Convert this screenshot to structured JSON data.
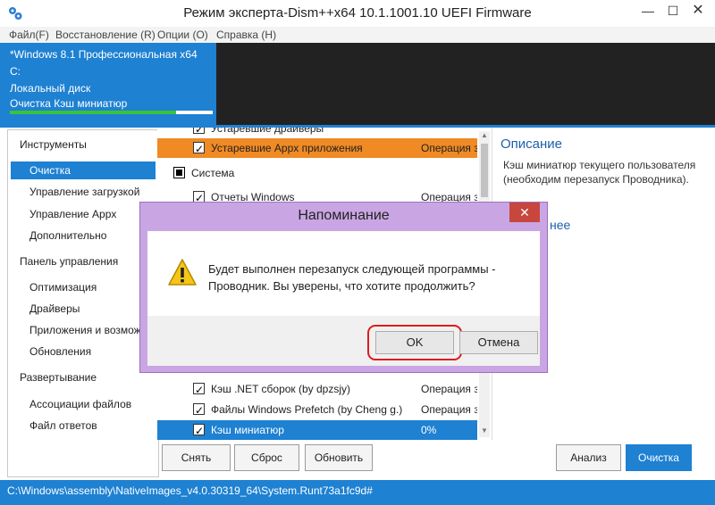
{
  "window": {
    "title": "Режим эксперта-Dism++x64 10.1.1001.10 UEFI Firmware",
    "minimize": "—",
    "maximize": "☐",
    "close": "✕"
  },
  "menu": {
    "items": [
      "Файл(F)",
      "Восстановление (R)",
      "Опции (O)",
      "Справка (H)"
    ]
  },
  "info_panel": {
    "os": "*Windows 8.1 Профессиональная x64",
    "drive": "C:",
    "disk_type": "Локальный диск",
    "task": "Очистка Кэш миниатюр",
    "progress": 0.82
  },
  "sidebar": {
    "sections": [
      {
        "title": "Инструменты",
        "items": [
          "Очистка",
          "Управление загрузкой",
          "Управление Appx",
          "Дополнительно"
        ]
      },
      {
        "title": "Панель управления",
        "items": [
          "Оптимизация",
          "Драйверы",
          "Приложения и возмож",
          "Обновления"
        ]
      },
      {
        "title": "Развертывание",
        "items": [
          "Ассоциации файлов",
          "Файл ответов"
        ]
      }
    ],
    "active_item": "Очистка"
  },
  "list": {
    "rows_top": [
      {
        "name": "Устаревшие драйверы",
        "status": "",
        "checked": true
      },
      {
        "name": "Устаревшие Appx приложения",
        "status": "Операция за",
        "checked": true
      }
    ],
    "group": "Система",
    "rows_mid": [
      {
        "name": "Отчеты Windows",
        "status": "Операция за",
        "checked": true
      }
    ],
    "rows_bottom": [
      {
        "name": "Кэш .NET сборок (by dpzsjy)",
        "status": "Операция за",
        "checked": true
      },
      {
        "name": "Файлы Windows Prefetch (by Cheng g.)",
        "status": "Операция за",
        "checked": true
      },
      {
        "name": "Кэш миниатюр",
        "status": "0%",
        "checked": true
      }
    ]
  },
  "description": {
    "title": "Описание",
    "text": "Кэш миниатюр текущего пользователя (необходим перезапуск Проводника).",
    "partial_heading": "нее"
  },
  "buttons": {
    "remove": "Снять",
    "reset": "Сброс",
    "refresh": "Обновить",
    "analyze": "Анализ",
    "clean": "Очистка"
  },
  "status": {
    "path": "C:\\Windows\\assembly\\NativeImages_v4.0.30319_64\\System.Runt73a1fc9d#"
  },
  "dialog": {
    "title": "Напоминание",
    "close": "✕",
    "message": "Будет выполнен перезапуск следующей программы - Проводник. Вы уверены, что хотите продолжить?",
    "ok": "OK",
    "cancel": "Отмена"
  },
  "colors": {
    "accent": "#1e81d2",
    "orange": "#f08a24",
    "dialog_frame": "#c9a6e3",
    "close_red": "#c7463e",
    "highlight": "#e01b1b"
  },
  "icons": {
    "app": "gears-icon",
    "warning": "warning-icon"
  }
}
